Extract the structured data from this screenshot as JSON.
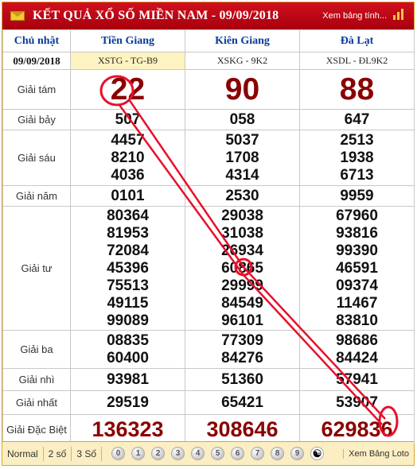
{
  "header": {
    "title": "KẾT QUẢ XỔ SỐ MIỀN NAM - 09/09/2018",
    "link": "Xem bảng tính..."
  },
  "columns": {
    "day": "Chủ nhật",
    "date": "09/09/2018",
    "provinces": [
      {
        "name": "Tiền Giang",
        "code": "XSTG - TG-B9"
      },
      {
        "name": "Kiên Giang",
        "code": "XSKG - 9K2"
      },
      {
        "name": "Đà Lạt",
        "code": "XSDL - ĐL9K2"
      }
    ]
  },
  "prizes": {
    "g8": {
      "label": "Giải tám",
      "values": [
        "22",
        "90",
        "88"
      ]
    },
    "g7": {
      "label": "Giải bảy",
      "values": [
        "507",
        "058",
        "647"
      ]
    },
    "g6": {
      "label": "Giải sáu",
      "values": [
        [
          "4457",
          "8210",
          "4036"
        ],
        [
          "5037",
          "1708",
          "4314"
        ],
        [
          "2513",
          "1938",
          "6713"
        ]
      ]
    },
    "g5": {
      "label": "Giải năm",
      "values": [
        "0101",
        "2530",
        "9959"
      ]
    },
    "g4": {
      "label": "Giải tư",
      "values": [
        [
          "80364",
          "81953",
          "72084",
          "45396",
          "75513",
          "49115",
          "99089"
        ],
        [
          "29038",
          "31038",
          "26934",
          "60865",
          "29999",
          "84549",
          "96101"
        ],
        [
          "67960",
          "93816",
          "99390",
          "46591",
          "09374",
          "11467",
          "83810"
        ]
      ]
    },
    "g3": {
      "label": "Giải ba",
      "values": [
        [
          "08835",
          "60400"
        ],
        [
          "77309",
          "84276"
        ],
        [
          "98686",
          "84424"
        ]
      ]
    },
    "g2": {
      "label": "Giải nhì",
      "values": [
        "93981",
        "51360",
        "57941"
      ]
    },
    "g1": {
      "label": "Giải nhất",
      "values": [
        "29519",
        "65421",
        "53907"
      ]
    },
    "db": {
      "label": "Giải Đặc Biệt",
      "values": [
        "136323",
        "308646",
        "629836"
      ]
    }
  },
  "footer": {
    "modes": [
      "Normal",
      "2 số",
      "3 Số"
    ],
    "digits": [
      "0",
      "1",
      "2",
      "3",
      "4",
      "5",
      "6",
      "7",
      "8",
      "9"
    ],
    "yin_yang": "☯",
    "loto_link": "Xem Bảng Loto"
  },
  "colors": {
    "header_red": "#c00010",
    "prize_red": "#8a0000",
    "province_blue": "#0a3a9a",
    "annotation_red": "#e8102a"
  }
}
